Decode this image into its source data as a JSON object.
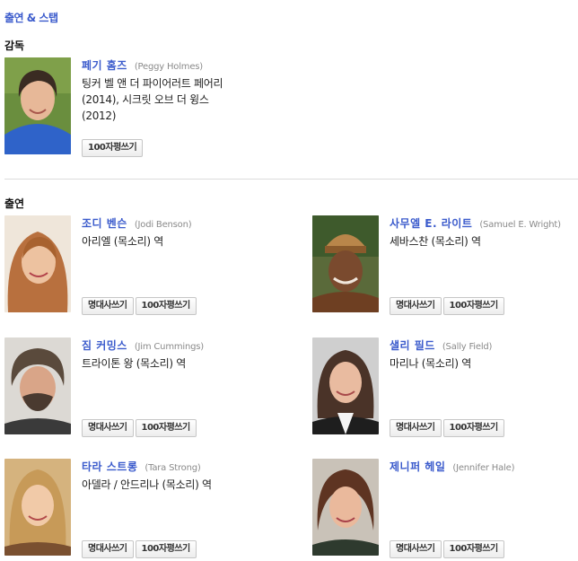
{
  "section_title": "출연 & 스탭",
  "director_heading": "감독",
  "cast_heading": "출연",
  "buttons": {
    "quote": "명대사쓰기",
    "review": "100자평쓰기"
  },
  "director": {
    "name": "페기 홈즈",
    "orig": "(Peggy Holmes)",
    "role": "팅커 벨 앤 더 파이어러트 페어리(2014), 시크릿 오브 더 윙스(2012)"
  },
  "cast": [
    {
      "name": "조디 벤슨",
      "orig": "(Jodi Benson)",
      "role": "아리엘 (목소리) 역"
    },
    {
      "name": "사무엘 E. 라이트",
      "orig": "(Samuel E. Wright)",
      "role": "세바스찬 (목소리) 역"
    },
    {
      "name": "짐 커밍스",
      "orig": "(Jim Cummings)",
      "role": "트라이톤 왕 (목소리) 역"
    },
    {
      "name": "샐리 필드",
      "orig": "(Sally Field)",
      "role": "마리나 (목소리) 역"
    },
    {
      "name": "타라 스트롱",
      "orig": "(Tara Strong)",
      "role": "아델라 / 안드리나 (목소리) 역"
    },
    {
      "name": "제니퍼 헤일",
      "orig": "(Jennifer Hale)",
      "role": ""
    }
  ]
}
